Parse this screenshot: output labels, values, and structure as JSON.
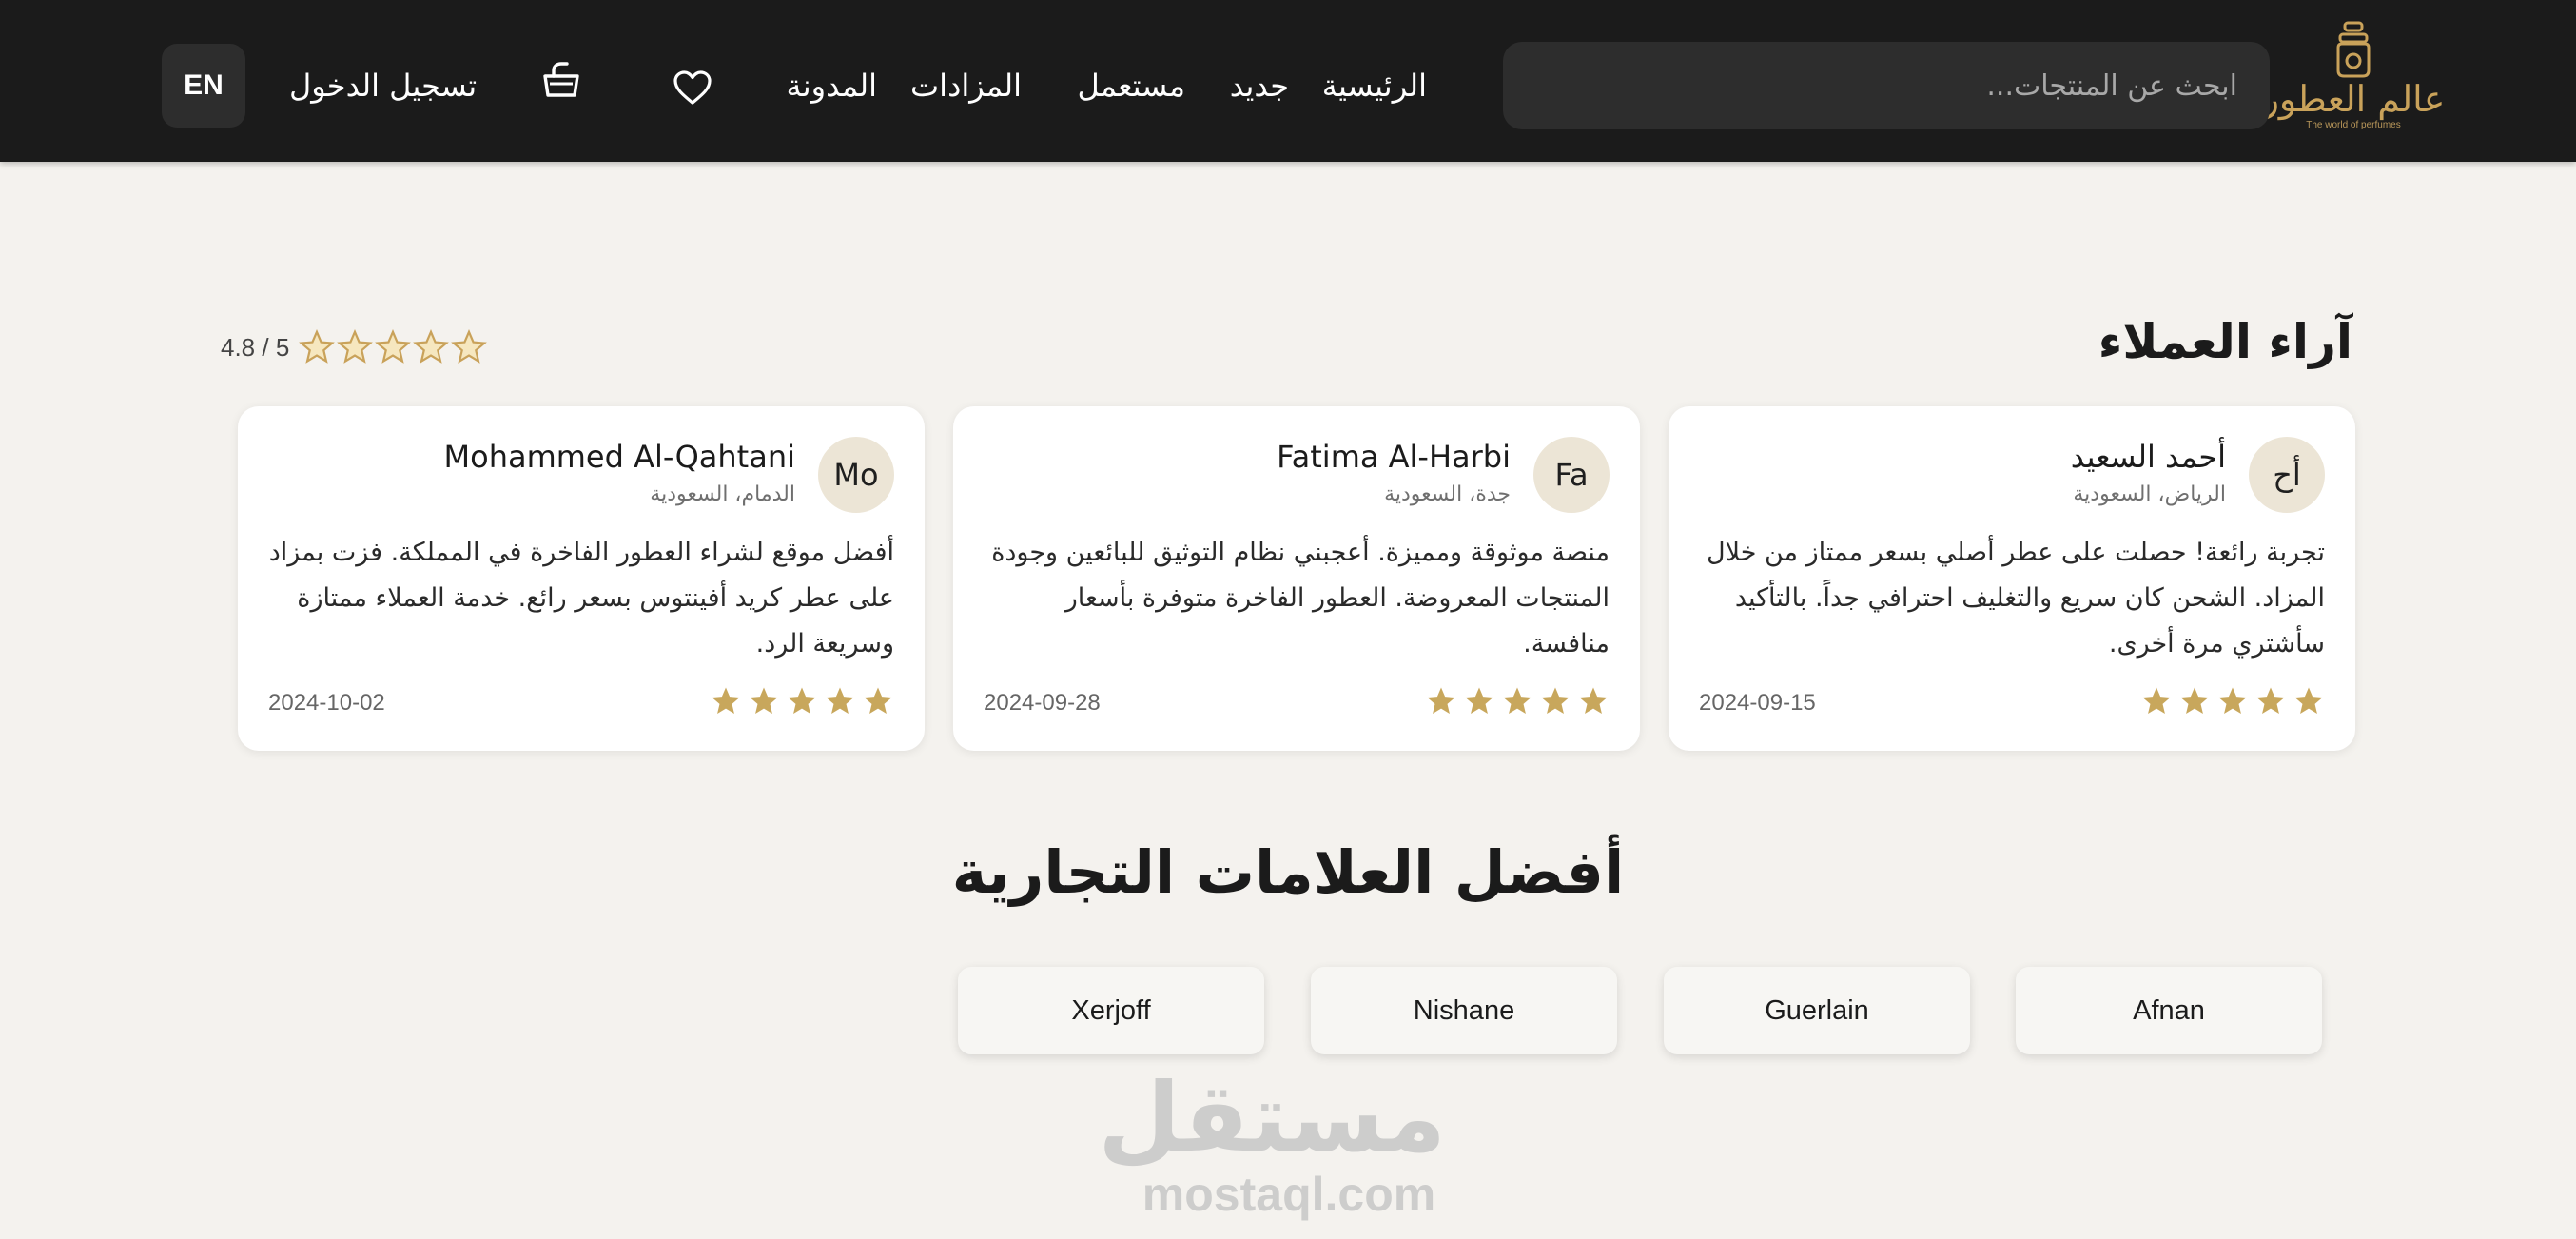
{
  "header": {
    "logo": {
      "name_ar": "عالم العطور",
      "tagline_en": "The world of perfumes"
    },
    "search": {
      "placeholder": "ابحث عن المنتجات...",
      "value": ""
    },
    "nav": {
      "home": "الرئيسية",
      "new": "جديد",
      "used": "مستعمل",
      "auctions": "المزادات",
      "blog": "المدونة"
    },
    "icons": {
      "wishlist": "heart-icon",
      "cart": "shopping-basket-icon"
    },
    "login_label": "تسجيل الدخول",
    "language_label": "EN"
  },
  "reviews": {
    "title": "آراء العملاء",
    "overall_rating_text": "4.8 / 5",
    "overall_stars": 5,
    "items": [
      {
        "initials": "أح",
        "name": "أحمد السعيد",
        "location": "الرياض، السعودية",
        "text": "تجربة رائعة! حصلت على عطر أصلي بسعر ممتاز من خلال المزاد. الشحن كان سريع والتغليف احترافي جداً. بالتأكيد سأشتري مرة أخرى.",
        "date": "2024-09-15",
        "stars": 5
      },
      {
        "initials": "Fa",
        "name": "Fatima Al-Harbi",
        "location": "جدة، السعودية",
        "text": "منصة موثوقة ومميزة. أعجبني نظام التوثيق للبائعين وجودة المنتجات المعروضة. العطور الفاخرة متوفرة بأسعار منافسة.",
        "date": "2024-09-28",
        "stars": 5
      },
      {
        "initials": "Mo",
        "name": "Mohammed Al-Qahtani",
        "location": "الدمام، السعودية",
        "text": "أفضل موقع لشراء العطور الفاخرة في المملكة. فزت بمزاد على عطر كريد أفينتوس بسعر رائع. خدمة العملاء ممتازة وسريعة الرد.",
        "date": "2024-10-02",
        "stars": 5
      }
    ]
  },
  "brands": {
    "title": "أفضل العلامات التجارية",
    "items": [
      "Afnan",
      "Guerlain",
      "Nishane",
      "Xerjoff"
    ]
  },
  "watermark": {
    "ar": "مستقل",
    "en": "mostaql.com"
  },
  "colors": {
    "header_bg": "#1b1b1b",
    "page_bg": "#f4f2ee",
    "gold": "#c9a25a",
    "star_gold": "#c8a75c"
  }
}
